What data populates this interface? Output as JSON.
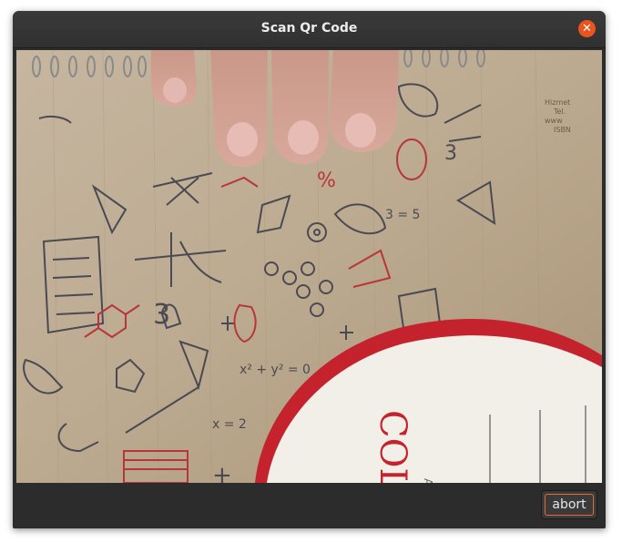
{
  "window": {
    "title": "Scan Qr Code",
    "close_icon": "close-icon",
    "accent_color": "#e9541f"
  },
  "camera_preview": {
    "description_icon": "camera-feed"
  },
  "footer": {
    "abort_label": "abort"
  }
}
